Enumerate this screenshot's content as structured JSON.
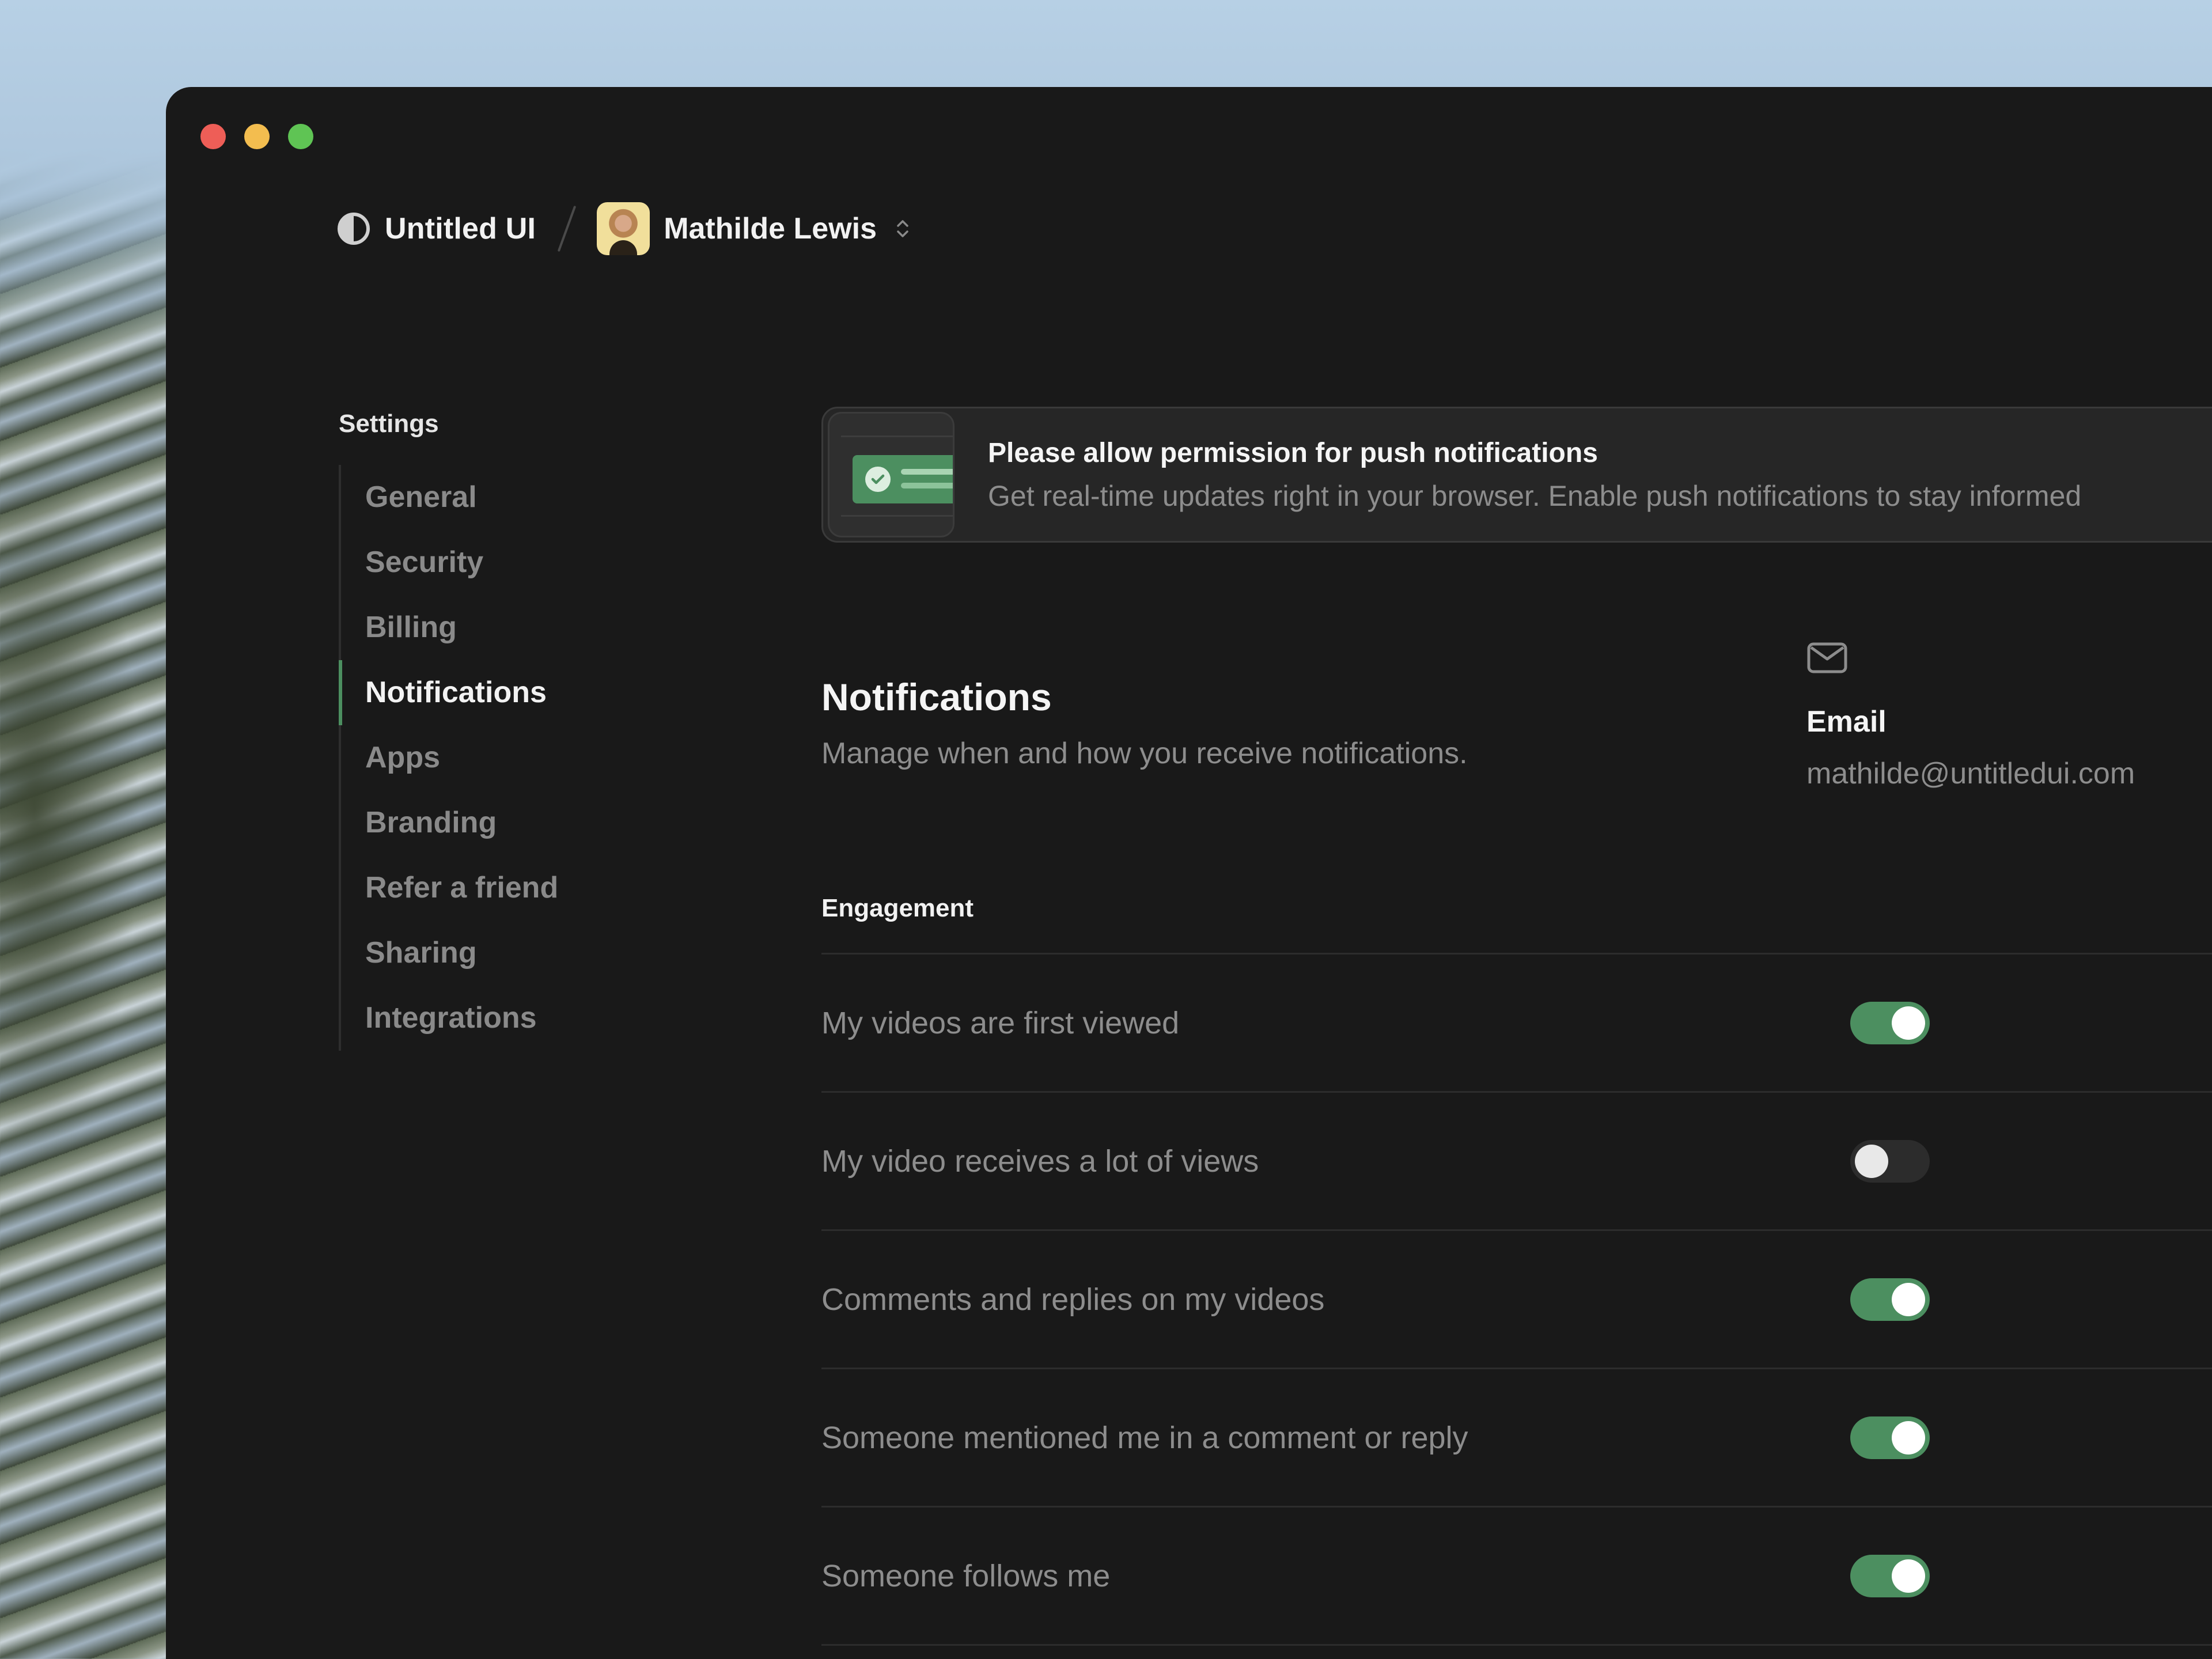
{
  "window": {
    "controls": [
      "close",
      "minimize",
      "maximize"
    ]
  },
  "header": {
    "brand": "Untitled UI",
    "brand_icon": "half-circle-logo-icon",
    "user_name": "Mathilde Lewis",
    "switcher_icon": "chevron-up-down-icon"
  },
  "sidebar": {
    "heading": "Settings",
    "items": [
      {
        "label": "General",
        "active": false
      },
      {
        "label": "Security",
        "active": false
      },
      {
        "label": "Billing",
        "active": false
      },
      {
        "label": "Notifications",
        "active": true
      },
      {
        "label": "Apps",
        "active": false
      },
      {
        "label": "Branding",
        "active": false
      },
      {
        "label": "Refer a friend",
        "active": false
      },
      {
        "label": "Sharing",
        "active": false
      },
      {
        "label": "Integrations",
        "active": false
      }
    ]
  },
  "banner": {
    "title": "Please allow permission for push notifications",
    "subtitle": "Get real-time updates right in your browser. Enable push notifications to stay informed"
  },
  "notifications": {
    "title": "Notifications",
    "subtitle": "Manage when and how you receive notifications.",
    "email_icon": "mail-icon",
    "email_label": "Email",
    "email_value": "mathilde@untitledui.com"
  },
  "engagement": {
    "label": "Engagement",
    "rows": [
      {
        "label": "My videos are first viewed",
        "enabled": true
      },
      {
        "label": "My video receives a lot of views",
        "enabled": false
      },
      {
        "label": "Comments and replies on my videos",
        "enabled": true
      },
      {
        "label": "Someone mentioned me in a comment or reply",
        "enabled": true
      },
      {
        "label": "Someone follows me",
        "enabled": true
      }
    ]
  },
  "colors": {
    "accent": "#4c8f60",
    "background": "#191919",
    "muted_text": "#8d8d8d"
  }
}
